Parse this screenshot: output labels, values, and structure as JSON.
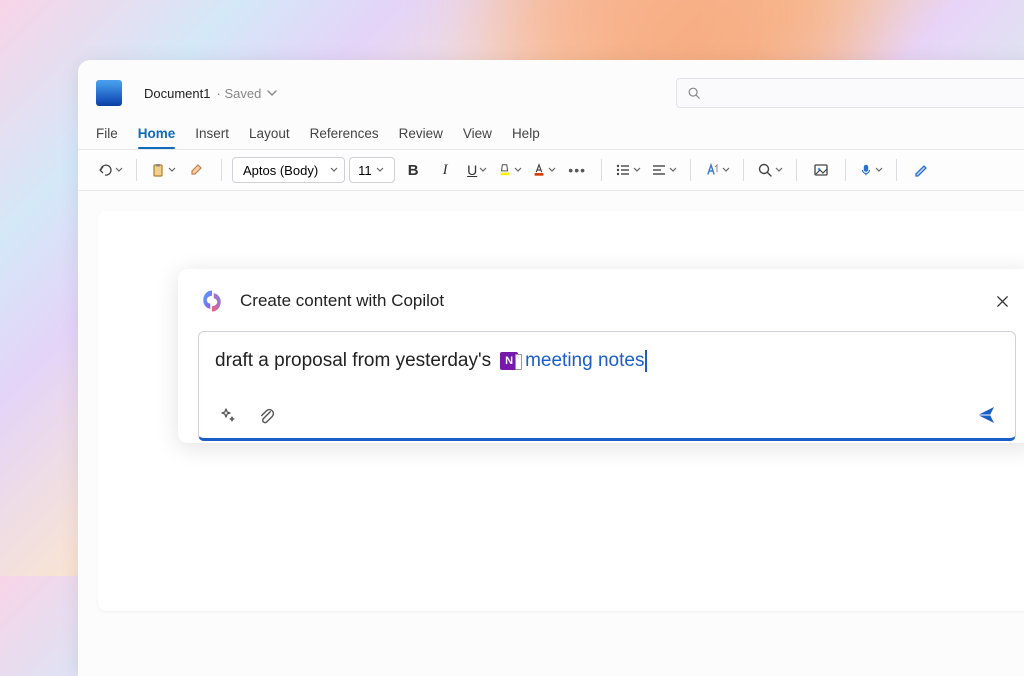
{
  "titlebar": {
    "documentName": "Document1",
    "saveStatus": "Saved"
  },
  "ribbon": {
    "tabs": [
      "File",
      "Home",
      "Insert",
      "Layout",
      "References",
      "Review",
      "View",
      "Help"
    ],
    "activeTab": "Home",
    "fontName": "Aptos (Body)",
    "fontSize": "11"
  },
  "copilot": {
    "title": "Create content with Copilot",
    "promptTextBefore": "draft a proposal from yesterday's ",
    "referenceApp": "N",
    "referenceLabel": "meeting notes"
  }
}
